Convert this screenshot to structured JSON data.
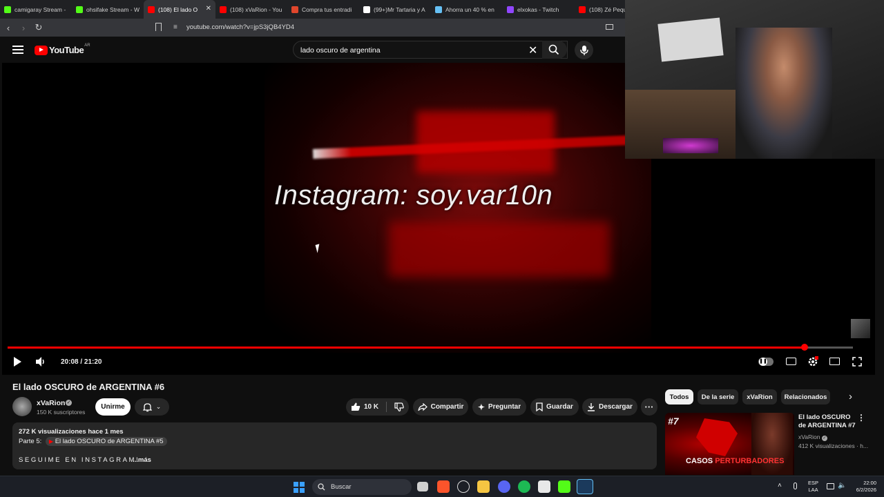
{
  "browser": {
    "tabs": [
      {
        "label": "camigaray Stream -",
        "color": "#53fc18"
      },
      {
        "label": "ohsifake Stream - W",
        "color": "#53fc18"
      },
      {
        "label": "(108) El lado O",
        "color": "#ff0000",
        "active": true
      },
      {
        "label": "(108) xVaRion - You",
        "color": "#ff0000"
      },
      {
        "label": "Compra tus entradi",
        "color": "#e0462c"
      },
      {
        "label": "(99+)Mr Tartaria y A",
        "color": "#ffffff"
      },
      {
        "label": "Ahorra un 40 % en",
        "color": "#66c0f4"
      },
      {
        "label": "elxokas - Twitch",
        "color": "#9146ff"
      },
      {
        "label": "(108) Zé Peque",
        "color": "#ff0000"
      }
    ],
    "url": "youtube.com/watch?v=jpS3jQB4YD4"
  },
  "youtube": {
    "logo_text": "YouTube",
    "country_code": "AR",
    "search_query": "lado oscuro de argentina"
  },
  "player": {
    "overlay_text": "Instagram: soy.var10n",
    "time_current": "20:08",
    "time_total": "21:20",
    "time_display": "20:08 / 21:20",
    "progress": 0.943
  },
  "video": {
    "title": "El lado OSCURO de ARGENTINA #6",
    "channel": "xVaRion",
    "subscribers": "150 K suscriptores",
    "join_label": "Unirme",
    "likes": "10 K",
    "share_label": "Compartir",
    "ask_label": "Preguntar",
    "save_label": "Guardar",
    "download_label": "Descargar"
  },
  "description": {
    "meta": "272 K visualizaciones  hace 1 mes",
    "part_prefix": "Parte 5:",
    "part_link": "El lado OSCURO de ARGENTINA #5",
    "instagram": "SEGUIME EN INSTAGRAM!",
    "more": "...más"
  },
  "filters": [
    "Todos",
    "De la serie",
    "xVaRion",
    "Relacionados"
  ],
  "recommended": {
    "number": "#7",
    "caption_white": "CASOS",
    "caption_red": "PERTURBADORES",
    "title": "El lado OSCURO de ARGENTINA #7",
    "channel": "xVaRion",
    "views": "412 K visualizaciones · h..."
  },
  "taskbar": {
    "search_placeholder": "Buscar",
    "lang_line1": "ESP",
    "lang_line2": "LAA",
    "time": "22:00",
    "date": "6/2/2026"
  }
}
